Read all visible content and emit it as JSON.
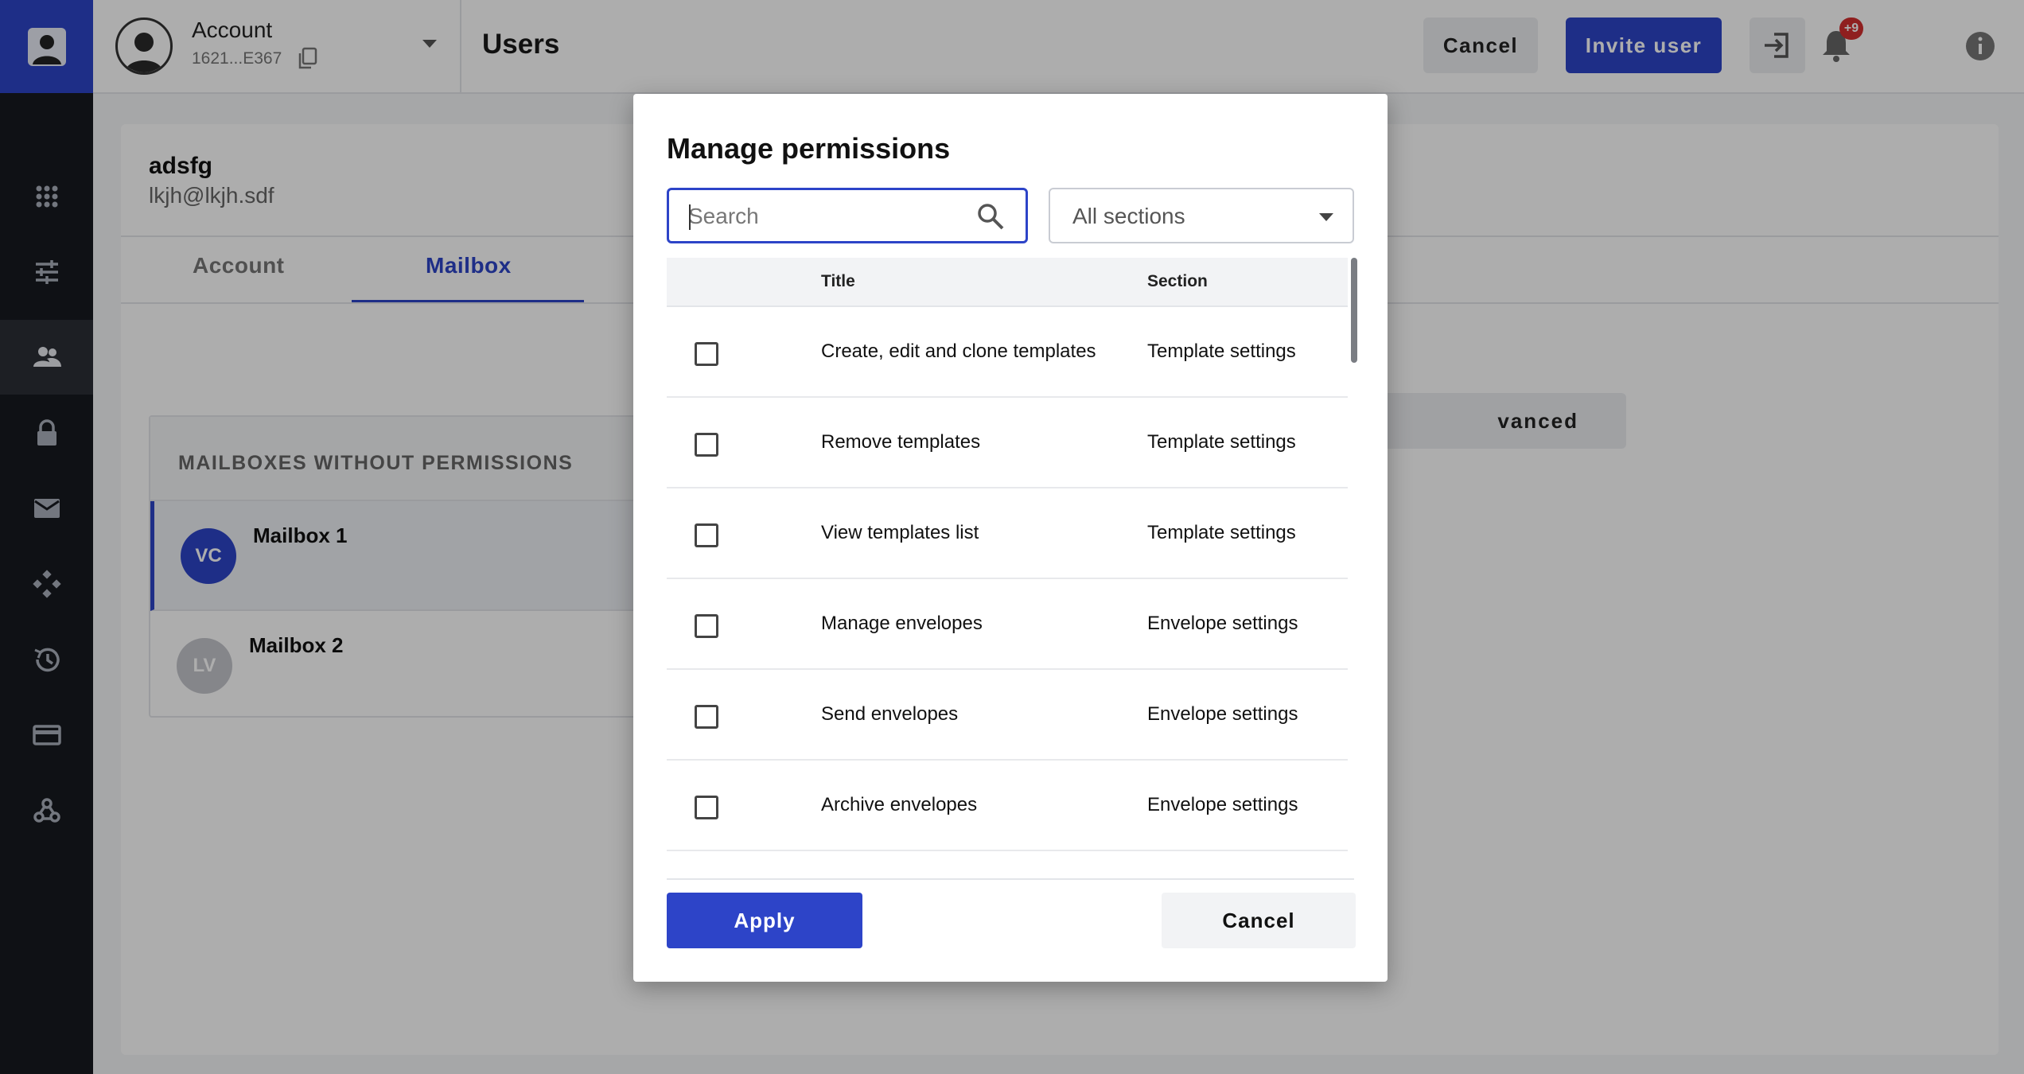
{
  "header": {
    "account_name": "Account",
    "account_id": "1621...E367",
    "page_title": "Users",
    "cancel_label": "Cancel",
    "invite_label": "Invite user",
    "notification_badge": "+9"
  },
  "sidebar": {
    "items": [
      {
        "icon": "apps-grid-icon"
      },
      {
        "icon": "sliders-icon"
      },
      {
        "icon": "users-icon",
        "active": true
      },
      {
        "icon": "lock-icon"
      },
      {
        "icon": "mail-icon"
      },
      {
        "icon": "integrations-icon"
      },
      {
        "icon": "history-icon"
      },
      {
        "icon": "billing-card-icon"
      },
      {
        "icon": "webhooks-icon"
      }
    ]
  },
  "user": {
    "name": "adsfg",
    "email": "lkjh@lkjh.sdf"
  },
  "tabs": [
    "Account",
    "Mailbox"
  ],
  "advanced_label": "vanced",
  "mailboxes": {
    "heading": "MAILBOXES WITHOUT PERMISSIONS",
    "items": [
      {
        "initials": "VC",
        "name": "Mailbox 1",
        "color": "#2d44c8"
      },
      {
        "initials": "LV",
        "name": "Mailbox 2",
        "color": "#c4c6cc"
      }
    ]
  },
  "modal": {
    "title": "Manage permissions",
    "search_placeholder": "Search",
    "section_filter": "All sections",
    "columns": {
      "title": "Title",
      "section": "Section"
    },
    "rows": [
      {
        "title": "Create, edit and clone templates",
        "section": "Template settings",
        "checked": false
      },
      {
        "title": "Remove templates",
        "section": "Template settings",
        "checked": false
      },
      {
        "title": "View templates list",
        "section": "Template settings",
        "checked": false
      },
      {
        "title": "Manage envelopes",
        "section": "Envelope settings",
        "checked": false
      },
      {
        "title": "Send envelopes",
        "section": "Envelope settings",
        "checked": false
      },
      {
        "title": "Archive envelopes",
        "section": "Envelope settings",
        "checked": false
      }
    ],
    "apply_label": "Apply",
    "cancel_label": "Cancel"
  },
  "colors": {
    "accent": "#2d44c8",
    "sidebar": "#171a1f",
    "badge": "#d32f2f"
  }
}
